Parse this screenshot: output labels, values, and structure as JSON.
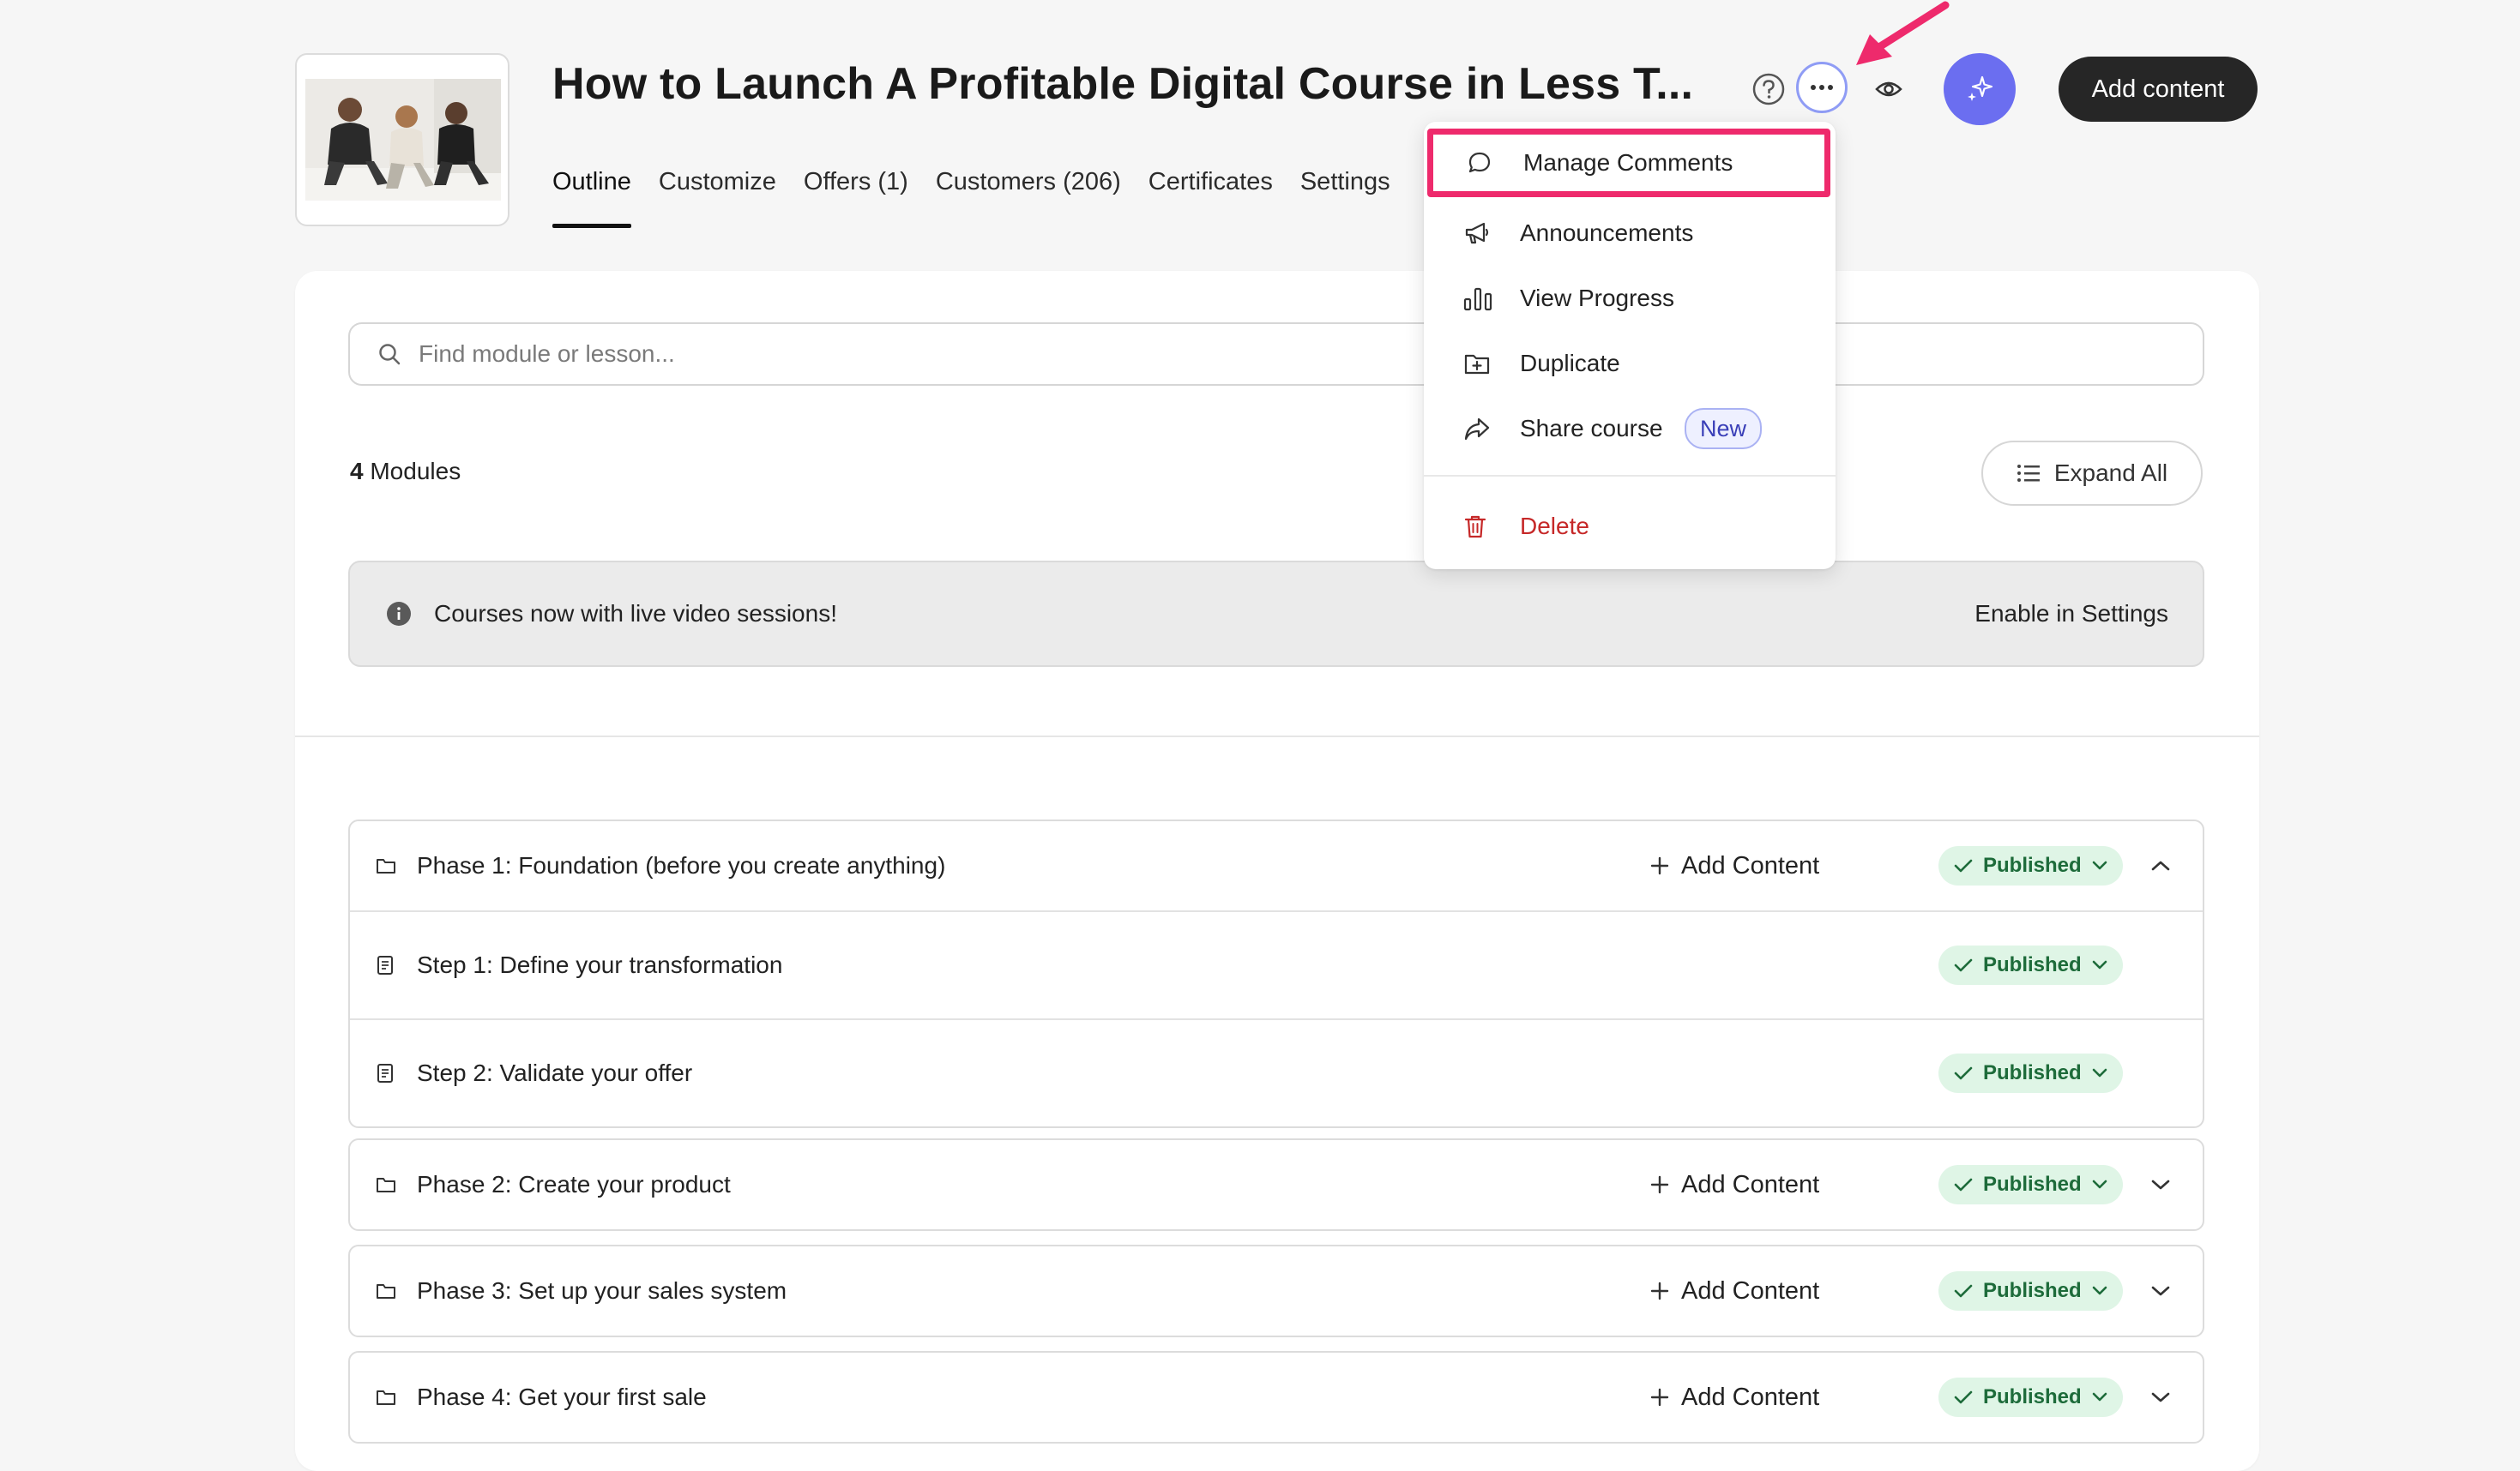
{
  "course": {
    "title": "How to Launch A Profitable Digital Course in Less T..."
  },
  "tabs": [
    {
      "label": "Outline"
    },
    {
      "label": "Customize"
    },
    {
      "label": "Offers (1)"
    },
    {
      "label": "Customers (206)"
    },
    {
      "label": "Certificates"
    },
    {
      "label": "Settings"
    }
  ],
  "header": {
    "add_content_label": "Add content"
  },
  "search": {
    "placeholder": "Find module or lesson..."
  },
  "modules": {
    "count": "4",
    "label": " Modules",
    "expand_label": "Expand All"
  },
  "banner": {
    "text": "Courses now with live video sessions!",
    "link": "Enable in Settings"
  },
  "menu": {
    "items": [
      {
        "label": "Manage Comments",
        "icon": "comment-icon"
      },
      {
        "label": "Announcements",
        "icon": "megaphone-icon"
      },
      {
        "label": "View Progress",
        "icon": "bar-chart-icon"
      },
      {
        "label": "Duplicate",
        "icon": "folder-plus-icon"
      },
      {
        "label": "Share course",
        "icon": "share-icon",
        "badge": "New"
      },
      {
        "label": "Delete",
        "icon": "trash-icon"
      }
    ]
  },
  "outline": {
    "add_content_label": "Add Content",
    "status_label": "Published",
    "phases": [
      {
        "title": "Phase 1: Foundation (before you create anything)",
        "lessons": [
          {
            "title": "Step 1: Define your transformation"
          },
          {
            "title": "Step 2: Validate your offer"
          }
        ]
      },
      {
        "title": "Phase 2: Create your product"
      },
      {
        "title": "Phase 3: Set up your sales system"
      },
      {
        "title": "Phase 4: Get your first sale"
      }
    ]
  },
  "colors": {
    "accent": "#6b6ef0",
    "highlight": "#ee2a6c",
    "published_bg": "#dff5e6",
    "published_text": "#1d6b3a",
    "danger": "#c62828"
  }
}
